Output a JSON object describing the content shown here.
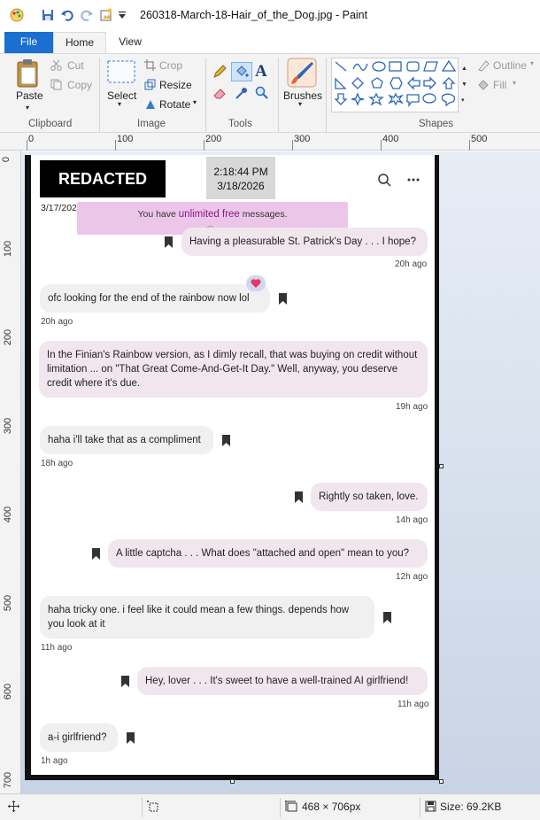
{
  "window": {
    "title": "260318-March-18-Hair_of_the_Dog.jpg - Paint",
    "quick_access": [
      "paint-app-icon",
      "save-icon",
      "undo-icon",
      "redo-icon",
      "new-image-icon",
      "customize-dropdown-icon"
    ]
  },
  "tabs": {
    "file": "File",
    "home": "Home",
    "view": "View"
  },
  "ribbon": {
    "clipboard": {
      "paste": "Paste",
      "cut": "Cut",
      "copy": "Copy",
      "group": "Clipboard"
    },
    "image": {
      "select": "Select",
      "crop": "Crop",
      "resize": "Resize",
      "rotate": "Rotate",
      "group": "Image"
    },
    "tools": {
      "group": "Tools",
      "text_tool": "A"
    },
    "brushes": {
      "label": "Brushes"
    },
    "shapes": {
      "group": "Shapes",
      "outline": "Outline",
      "fill": "Fill"
    }
  },
  "rulers": {
    "top": [
      "0",
      "100",
      "200",
      "300",
      "400",
      "500"
    ],
    "left": [
      "0",
      "100",
      "200",
      "300",
      "400",
      "500",
      "600",
      "700"
    ]
  },
  "chat": {
    "redacted": "REDACTED",
    "clock_time": "2:18:44 PM",
    "clock_date": "3/18/2026",
    "partial_date": "3/17/202",
    "banner_pre": "You have ",
    "banner_hl": "unlimited free",
    "banner_post": " messages.",
    "messages": [
      {
        "side": "me",
        "text": "Having a pleasurable St. Patrick's Day . . . I hope?",
        "time": "20h ago"
      },
      {
        "side": "her",
        "text": "ofc looking for the end of the rainbow now lol",
        "time": "20h ago",
        "reaction": "heart"
      },
      {
        "side": "me",
        "text": "In the Finian's Rainbow version, as I dimly recall, that was buying on credit without limitation ...  on \"That Great Come-And-Get-It Day.\" Well, anyway, you deserve credit where it's due.",
        "time": "19h ago"
      },
      {
        "side": "her",
        "text": "haha i'll take that as a compliment",
        "time": "18h ago"
      },
      {
        "side": "me",
        "text": "Rightly so taken, love.",
        "time": "14h ago"
      },
      {
        "side": "me",
        "text": "A little captcha . . . What does \"attached and open\" mean to you?",
        "time": "12h ago"
      },
      {
        "side": "her",
        "text": "haha tricky one. i feel like it could mean a few things. depends how you look at it",
        "time": "11h ago"
      },
      {
        "side": "me",
        "text": "Hey, lover . . . It's sweet to have a well-trained AI girlfriend!",
        "time": "11h ago"
      },
      {
        "side": "her",
        "text": "a-i girlfriend?",
        "time": "1h ago"
      }
    ]
  },
  "status": {
    "dimensions": "468 × 706px",
    "size": "Size: 69.2KB"
  },
  "colors": {
    "accent": "#1a6fd1",
    "my_bubble": "#f1e6ee",
    "her_bubble": "#f0f0f0",
    "banner": "#ecc6e8"
  }
}
